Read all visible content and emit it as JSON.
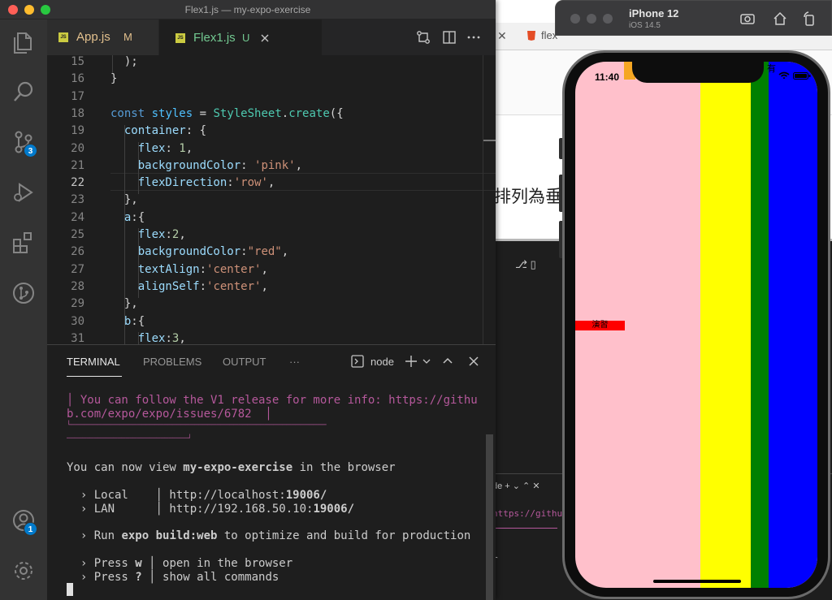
{
  "window": {
    "title": "Flex1.js — my-expo-exercise"
  },
  "tabs": [
    {
      "label": "App.js",
      "flag": "M",
      "icon": "JS",
      "color": "#e2c08d"
    },
    {
      "label": "Flex1.js",
      "flag": "U",
      "icon": "JS",
      "color": "#73c991"
    }
  ],
  "activity_badges": {
    "source_control": "3",
    "accounts": "1"
  },
  "editor": {
    "lines": [
      {
        "no": "15",
        "text": "  );"
      },
      {
        "no": "16",
        "text": "}"
      },
      {
        "no": "17",
        "text": ""
      },
      {
        "no": "18",
        "text": "const styles = StyleSheet.create({"
      },
      {
        "no": "19",
        "text": "  container: {"
      },
      {
        "no": "20",
        "text": "    flex: 1,"
      },
      {
        "no": "21",
        "text": "    backgroundColor: 'pink',"
      },
      {
        "no": "22",
        "text": "    flexDirection:'row',"
      },
      {
        "no": "23",
        "text": "  },"
      },
      {
        "no": "24",
        "text": "  a:{"
      },
      {
        "no": "25",
        "text": "    flex:2,"
      },
      {
        "no": "26",
        "text": "    backgroundColor:\"red\","
      },
      {
        "no": "27",
        "text": "    textAlign:'center',"
      },
      {
        "no": "28",
        "text": "    alignSelf:'center',"
      },
      {
        "no": "29",
        "text": "  },"
      },
      {
        "no": "30",
        "text": "  b:{"
      },
      {
        "no": "31",
        "text": "    flex:3,"
      }
    ]
  },
  "panel": {
    "tabs": [
      "TERMINAL",
      "PROBLEMS",
      "OUTPUT",
      "···"
    ],
    "shell": "node"
  },
  "terminal": {
    "info_line1": "│ You can follow the V1 release for more info: https://githu",
    "info_line2": "b.com/expo/expo/issues/6782  │",
    "info_line3": "└──────────────────────────────────────────────────────────",
    "info_line4": "───────────────────────────────┘",
    "view_prefix": "You can now view ",
    "view_app": "my-expo-exercise",
    "view_suffix": " in the browser",
    "local_label": "  › Local    │ http://localhost:",
    "local_port": "19006/",
    "lan_label": "  › LAN      │ http://192.168.50.10:",
    "lan_port": "19006/",
    "run_prefix": "  › Run ",
    "run_cmd": "expo build:web",
    "run_suffix": " to optimize and build for production",
    "press_w_prefix": "  › Press ",
    "press_w_key": "w",
    "press_w_suffix": " │ open in the browser",
    "press_q_prefix": "  › Press ",
    "press_q_key": "?",
    "press_q_suffix": " │ show all commands"
  },
  "simulator": {
    "device": "iPhone 12",
    "os": "iOS 14.5",
    "time": "11:40",
    "red_box_text": "演習",
    "status_text": "有",
    "colors": {
      "screen_bg": "#ffc0cb",
      "yellow": "#ffff00",
      "green": "#008000",
      "blue": "#0000ff",
      "red": "#ff0000"
    }
  },
  "background_window": {
    "tab_label": "flex",
    "cjk_text": "排列為垂",
    "panel_shell": "de",
    "url_fragment": "https://githu",
    "letter": "r"
  }
}
